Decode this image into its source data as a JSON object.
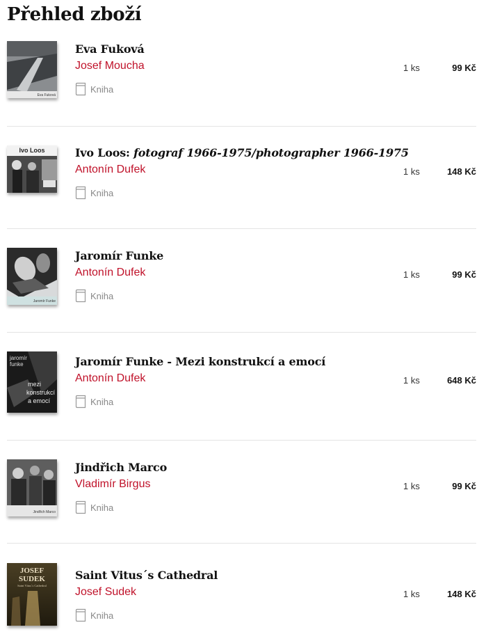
{
  "page": {
    "title": "Přehled zboží"
  },
  "items": [
    {
      "title": "Eva Fuková",
      "subtitle": "",
      "author": "Josef Moucha",
      "type": "Kniha",
      "qty": "1 ks",
      "price": "99 Kč",
      "cover_text": "Eva Fuková"
    },
    {
      "title": "Ivo Loos: ",
      "subtitle": "fotograf 1966-1975/photographer 1966-1975",
      "author": "Antonín Dufek",
      "type": "Kniha",
      "qty": "1 ks",
      "price": "148 Kč",
      "cover_text": "Ivo Loos"
    },
    {
      "title": "Jaromír Funke",
      "subtitle": "",
      "author": "Antonín Dufek",
      "type": "Kniha",
      "qty": "1 ks",
      "price": "99 Kč",
      "cover_text": "Jaromír Funke"
    },
    {
      "title": "Jaromír Funke - Mezi konstrukcí a emocí",
      "subtitle": "",
      "author": "Antonín Dufek",
      "type": "Kniha",
      "qty": "1 ks",
      "price": "648 Kč",
      "cover_text": "Jaromír Funke mezi konstrukcí a emocí"
    },
    {
      "title": "Jindřich Marco",
      "subtitle": "",
      "author": "Vladimír Birgus",
      "type": "Kniha",
      "qty": "1 ks",
      "price": "99 Kč",
      "cover_text": "Jindřich Marco"
    },
    {
      "title": "Saint Vitus´s Cathedral",
      "subtitle": "",
      "author": "Josef Sudek",
      "type": "Kniha",
      "qty": "1 ks",
      "price": "148 Kč",
      "cover_text": "JOSEF SUDEK Saint Vitus´s Cathedral"
    }
  ],
  "colors": {
    "author": "#c0122a",
    "divider": "#e4e4e4"
  }
}
